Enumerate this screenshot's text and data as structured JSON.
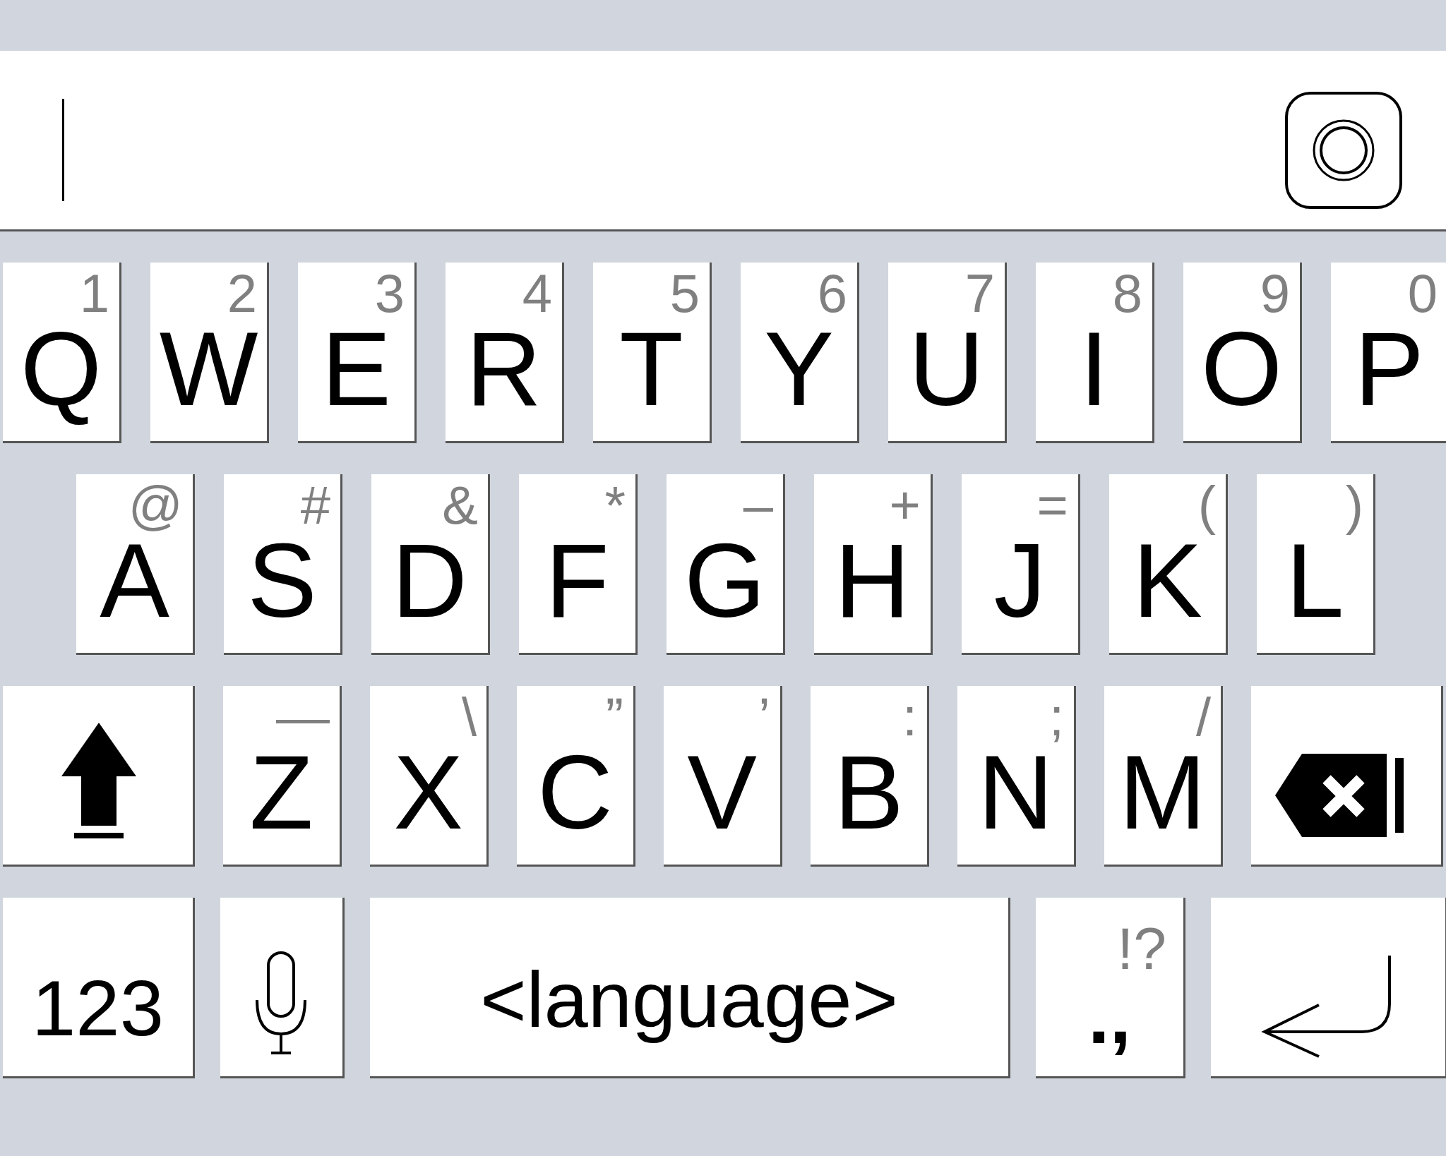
{
  "input": {
    "caret": true
  },
  "rows": [
    [
      {
        "kind": "char",
        "label": "Q",
        "secondary": "1"
      },
      {
        "kind": "char",
        "label": "W",
        "secondary": "2"
      },
      {
        "kind": "char",
        "label": "E",
        "secondary": "3"
      },
      {
        "kind": "char",
        "label": "R",
        "secondary": "4"
      },
      {
        "kind": "char",
        "label": "T",
        "secondary": "5"
      },
      {
        "kind": "char",
        "label": "Y",
        "secondary": "6"
      },
      {
        "kind": "char",
        "label": "U",
        "secondary": "7"
      },
      {
        "kind": "char",
        "label": "I",
        "secondary": "8"
      },
      {
        "kind": "char",
        "label": "O",
        "secondary": "9"
      },
      {
        "kind": "char",
        "label": "P",
        "secondary": "0"
      }
    ],
    [
      {
        "kind": "char",
        "label": "A",
        "secondary": "@"
      },
      {
        "kind": "char",
        "label": "S",
        "secondary": "#"
      },
      {
        "kind": "char",
        "label": "D",
        "secondary": "&"
      },
      {
        "kind": "char",
        "label": "F",
        "secondary": "*"
      },
      {
        "kind": "char",
        "label": "G",
        "secondary": "–"
      },
      {
        "kind": "char",
        "label": "H",
        "secondary": "+"
      },
      {
        "kind": "char",
        "label": "J",
        "secondary": "="
      },
      {
        "kind": "char",
        "label": "K",
        "secondary": "("
      },
      {
        "kind": "char",
        "label": "L",
        "secondary": ")"
      }
    ],
    [
      {
        "kind": "shift"
      },
      {
        "kind": "char",
        "label": "Z",
        "secondary": "—"
      },
      {
        "kind": "char",
        "label": "X",
        "secondary": "\\"
      },
      {
        "kind": "char",
        "label": "C",
        "secondary": "”"
      },
      {
        "kind": "char",
        "label": "V",
        "secondary": "’"
      },
      {
        "kind": "char",
        "label": "B",
        "secondary": ":"
      },
      {
        "kind": "char",
        "label": "N",
        "secondary": ";"
      },
      {
        "kind": "char",
        "label": "M",
        "secondary": "/"
      },
      {
        "kind": "backspace"
      }
    ],
    [
      {
        "kind": "mode",
        "label": "123"
      },
      {
        "kind": "mic"
      },
      {
        "kind": "space",
        "label": "<language>"
      },
      {
        "kind": "punct",
        "label": ".,",
        "secondary": "!?"
      },
      {
        "kind": "enter"
      }
    ]
  ]
}
